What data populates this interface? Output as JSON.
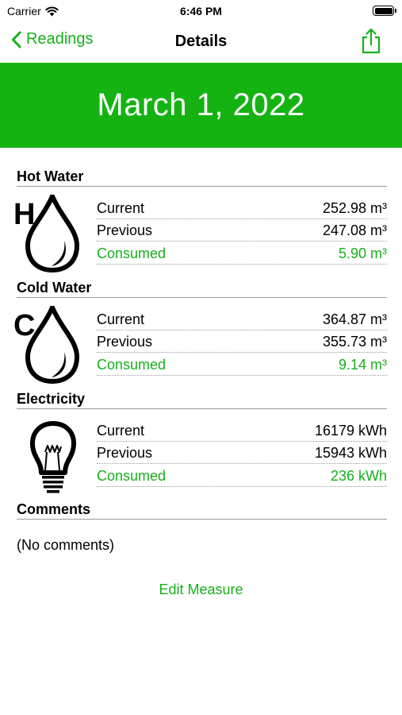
{
  "status_bar": {
    "carrier": "Carrier",
    "time": "6:46 PM",
    "battery_level": 1.0
  },
  "nav": {
    "back_label": "Readings",
    "title": "Details",
    "back_icon": "chevron-left-icon",
    "share_icon": "share-icon"
  },
  "banner": {
    "date": "March 1, 2022"
  },
  "colors": {
    "accent": "#16b01a",
    "banner": "#14b312"
  },
  "sections": [
    {
      "title": "Hot Water",
      "icon": "hot-water-drop-icon",
      "rows": [
        {
          "label": "Current",
          "value": "252.98 m³"
        },
        {
          "label": "Previous",
          "value": "247.08 m³"
        },
        {
          "label": "Consumed",
          "value": "5.90 m³"
        }
      ]
    },
    {
      "title": "Cold Water",
      "icon": "cold-water-drop-icon",
      "rows": [
        {
          "label": "Current",
          "value": "364.87 m³"
        },
        {
          "label": "Previous",
          "value": "355.73 m³"
        },
        {
          "label": "Consumed",
          "value": "9.14 m³"
        }
      ]
    },
    {
      "title": "Electricity",
      "icon": "light-bulb-icon",
      "rows": [
        {
          "label": "Current",
          "value": "16179 kWh"
        },
        {
          "label": "Previous",
          "value": "15943 kWh"
        },
        {
          "label": "Consumed",
          "value": "236 kWh"
        }
      ]
    }
  ],
  "comments": {
    "title": "Comments",
    "text": "(No comments)"
  },
  "edit_button": {
    "label": "Edit Measure"
  }
}
